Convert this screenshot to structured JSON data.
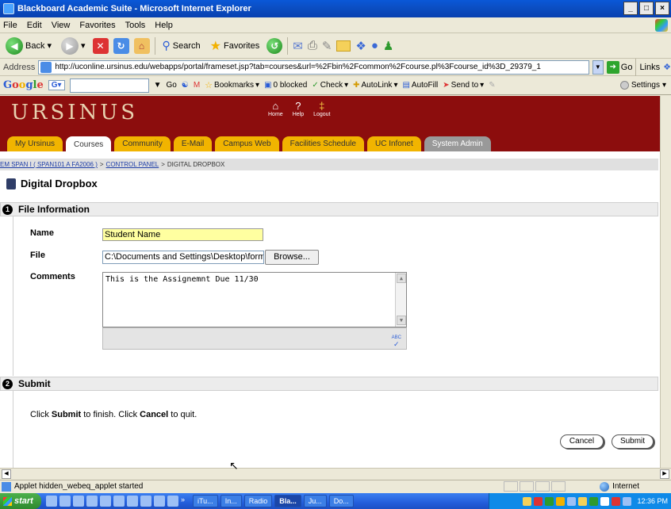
{
  "window": {
    "title": "Blackboard Academic Suite - Microsoft Internet Explorer",
    "controls": [
      "_",
      "□",
      "×"
    ]
  },
  "menu": [
    "File",
    "Edit",
    "View",
    "Favorites",
    "Tools",
    "Help"
  ],
  "toolbar": {
    "back_label": "Back",
    "search_label": "Search",
    "favorites_label": "Favorites"
  },
  "address": {
    "label": "Address",
    "url": "http://uconline.ursinus.edu/webapps/portal/frameset.jsp?tab=courses&url=%2Fbin%2Fcommon%2Fcourse.pl%3Fcourse_id%3D_29379_1",
    "go_label": "Go",
    "links_label": "Links"
  },
  "googlebar": {
    "logo_letters": [
      "G",
      "o",
      "o",
      "g",
      "l",
      "e"
    ],
    "go_label": "Go",
    "bookmarks_label": "Bookmarks",
    "blocked_label": "0 blocked",
    "check_label": "Check",
    "autolink_label": "AutoLink",
    "autofill_label": "AutoFill",
    "sendto_label": "Send to",
    "settings_label": "Settings"
  },
  "portal": {
    "brand": "URSINUS",
    "top_icons": [
      {
        "glyph": "⌂",
        "label": "Home"
      },
      {
        "glyph": "?",
        "label": "Help"
      },
      {
        "glyph": "‡",
        "label": "Logout"
      }
    ],
    "tabs": [
      "My Ursinus",
      "Courses",
      "Community",
      "E-Mail",
      "Campus Web",
      "Facilities Schedule",
      "UC Infonet",
      "System Admin"
    ],
    "active_tab": "Courses"
  },
  "breadcrumb": {
    "course": "EM SPAN I ( SPAN101 A FA2006 )",
    "control_panel": "CONTROL PANEL",
    "current": "DIGITAL DROPBOX",
    "separator": ">"
  },
  "page_title": "Digital Dropbox",
  "file_info": {
    "step": "1",
    "heading": "File Information",
    "name_label": "Name",
    "name_value": "Student Name",
    "file_label": "File",
    "file_value": "C:\\Documents and Settings\\Desktop\\form",
    "browse_label": "Browse...",
    "comments_label": "Comments",
    "comments_value": "This is the Assignemnt Due 11/30",
    "spell_label": "ABC"
  },
  "submit_section": {
    "step": "2",
    "heading": "Submit",
    "instr_part1": "Click ",
    "instr_submit": "Submit",
    "instr_part2": " to finish. Click ",
    "instr_cancel": "Cancel",
    "instr_part3": " to quit.",
    "cancel_label": "Cancel",
    "submit_label": "Submit"
  },
  "status": {
    "text": "Applet hidden_webeq_applet started",
    "zone": "Internet"
  },
  "taskbar": {
    "start_label": "start",
    "items": [
      "iTu...",
      "In...",
      "Radio",
      "Bla...",
      "Ju...",
      "Do..."
    ],
    "active_item": "Bla...",
    "clock": "12:36 PM"
  },
  "colors": {
    "banner": "#8c0d0d",
    "tab": "#f1b400",
    "name_field_bg": "#ffffa0"
  }
}
